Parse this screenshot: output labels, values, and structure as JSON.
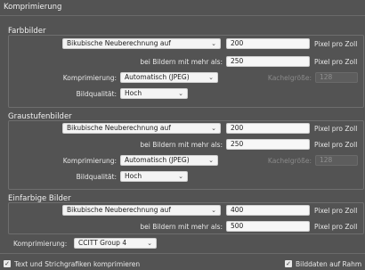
{
  "header": {
    "title": "Komprimierung"
  },
  "color_images": {
    "title": "Farbbilder",
    "method": "Bikubische Neuberechnung auf",
    "ppi_value": "200",
    "ppi_unit": "Pixel pro Zoll",
    "above_label": "bei Bildern mit mehr als:",
    "above_value": "250",
    "above_unit": "Pixel pro Zoll",
    "compression_label": "Komprimierung:",
    "compression_value": "Automatisch (JPEG)",
    "tile_label": "Kachelgröße:",
    "tile_value": "128",
    "quality_label": "Bildqualität:",
    "quality_value": "Hoch"
  },
  "grayscale_images": {
    "title": "Graustufenbilder",
    "method": "Bikubische Neuberechnung auf",
    "ppi_value": "200",
    "ppi_unit": "Pixel pro Zoll",
    "above_label": "bei Bildern mit mehr als:",
    "above_value": "250",
    "above_unit": "Pixel pro Zoll",
    "compression_label": "Komprimierung:",
    "compression_value": "Automatisch (JPEG)",
    "tile_label": "Kachelgröße:",
    "tile_value": "128",
    "quality_label": "Bildqualität:",
    "quality_value": "Hoch"
  },
  "monochrome_images": {
    "title": "Einfarbige Bilder",
    "method": "Bikubische Neuberechnung auf",
    "ppi_value": "400",
    "ppi_unit": "Pixel pro Zoll",
    "above_label": "bei Bildern mit mehr als:",
    "above_value": "500",
    "above_unit": "Pixel pro Zoll",
    "compression_label": "Komprimierung:",
    "compression_value": "CCITT Group 4"
  },
  "footer": {
    "compress_text_label": "Text und Strichgrafiken komprimieren",
    "crop_label": "Bilddaten auf Rahm"
  }
}
